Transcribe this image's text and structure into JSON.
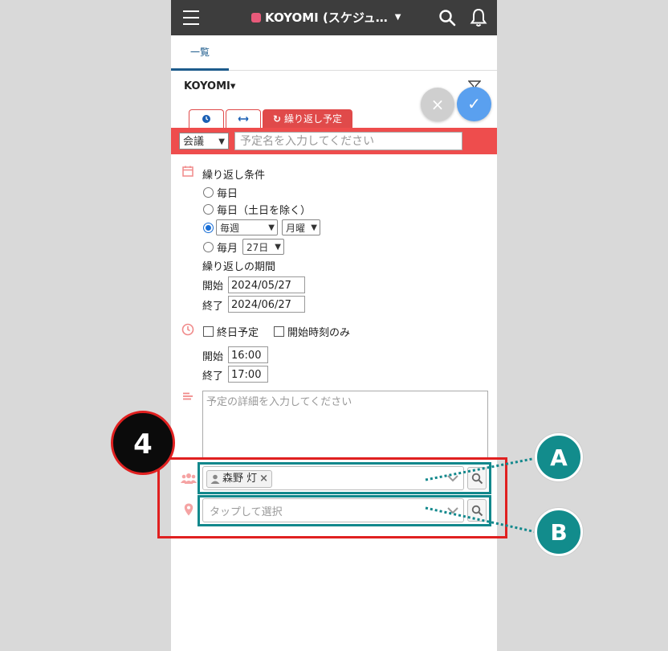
{
  "topbar": {
    "app_title": "KOYOMI (スケジュ…",
    "caret": "▼"
  },
  "tabs": [
    {
      "label": "一覧"
    }
  ],
  "koyomi": {
    "name": "KOYOMI▾"
  },
  "fab": {
    "close": "×",
    "confirm": "✓"
  },
  "subtabs": {
    "repeat_label": "繰り返し予定"
  },
  "event": {
    "type_value": "会議",
    "title_placeholder": "予定名を入力してください"
  },
  "repeat": {
    "heading": "繰り返し条件",
    "option_daily": "毎日",
    "option_weekdays": "毎日（土日を除く）",
    "weekly_select": "毎週",
    "weekday_select": "月曜",
    "option_monthly": "毎月",
    "monthly_day": "27日",
    "period_heading": "繰り返しの期間",
    "start_label": "開始",
    "start_date": "2024/05/27",
    "end_label": "終了",
    "end_date": "2024/06/27"
  },
  "time": {
    "all_day": "終日予定",
    "start_only": "開始時刻のみ",
    "start_label": "開始",
    "start_time": "16:00",
    "end_label": "終了",
    "end_time": "17:00"
  },
  "detail": {
    "placeholder": "予定の詳細を入力してください"
  },
  "participants": {
    "chip": "森野 灯"
  },
  "facility": {
    "placeholder": "タップして選択"
  },
  "annotations": {
    "step": "4",
    "label_a": "A",
    "label_b": "B"
  },
  "colors": {
    "accent_red": "#ee4d4d",
    "teal": "#12888c",
    "topbar": "#3d3d3d",
    "primary_blue": "#5aa0ef"
  }
}
